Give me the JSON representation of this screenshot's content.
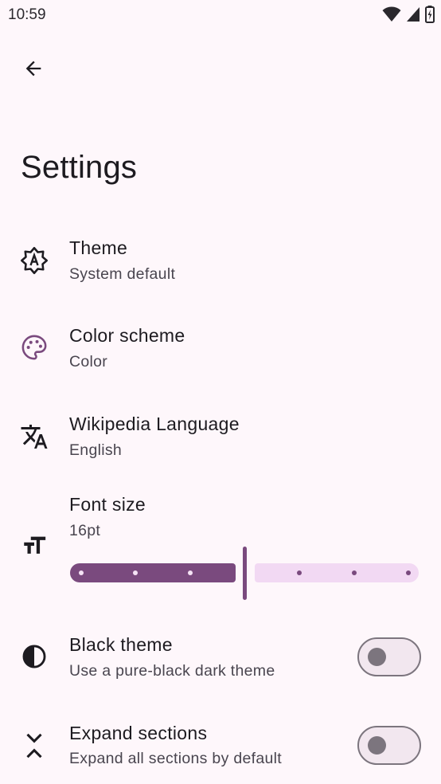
{
  "status_bar": {
    "time": "10:59",
    "icons": [
      "wifi-icon",
      "cell-signal-icon",
      "battery-icon"
    ]
  },
  "top_bar": {
    "back_icon": "arrow-back-icon",
    "title": "Settings"
  },
  "settings": {
    "theme": {
      "icon": "auto-brightness-icon",
      "title": "Theme",
      "subtitle": "System default"
    },
    "color_scheme": {
      "icon": "palette-icon",
      "title": "Color scheme",
      "subtitle": "Color"
    },
    "language": {
      "icon": "translate-icon",
      "title": "Wikipedia Language",
      "subtitle": "English"
    },
    "font_size": {
      "icon": "text-size-icon",
      "title": "Font size",
      "subtitle": "16pt",
      "slider": {
        "steps": 7,
        "selected_index": 3
      }
    },
    "black_theme": {
      "icon": "contrast-icon",
      "title": "Black theme",
      "subtitle": "Use a pure-black dark theme",
      "enabled": false
    },
    "expand_sections": {
      "icon": "unfold-icon",
      "title": "Expand sections",
      "subtitle": "Expand all sections by default",
      "enabled": false
    }
  },
  "colors": {
    "background": "#fef7fb",
    "accent": "#7a4a7e",
    "accent_light": "#f2d9f3",
    "text_primary": "#1d1b20",
    "text_secondary": "#49454f"
  }
}
